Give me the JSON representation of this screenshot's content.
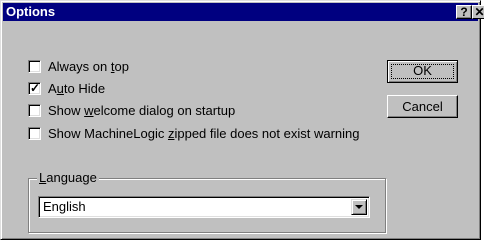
{
  "window": {
    "title": "Options",
    "help_glyph": "?",
    "close_glyph": "✕"
  },
  "options": [
    {
      "pre": "Always on ",
      "accel": "t",
      "post": "op",
      "checked": false
    },
    {
      "pre": "A",
      "accel": "u",
      "post": "to Hide",
      "checked": true
    },
    {
      "pre": "Show ",
      "accel": "w",
      "post": "elcome dialog on startup",
      "checked": false
    },
    {
      "pre": "Show MachineLogic ",
      "accel": "z",
      "post": "ipped file does not exist warning",
      "checked": false
    }
  ],
  "checkmark": "✓",
  "buttons": {
    "ok": "OK",
    "cancel": "Cancel"
  },
  "language": {
    "group_label_accel": "L",
    "group_label_rest": "anguage",
    "selected": "English"
  },
  "colors": {
    "face": "#c0c0c0",
    "titlebar": "#000080"
  }
}
